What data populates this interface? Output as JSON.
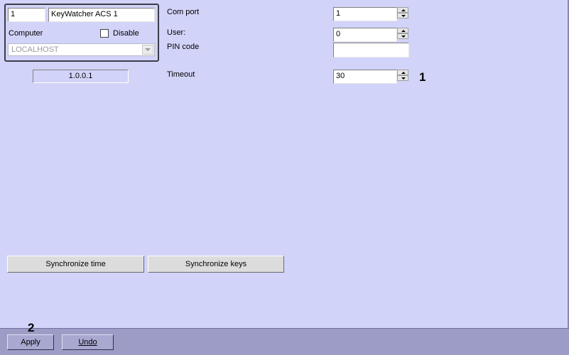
{
  "object_panel": {
    "id_value": "1",
    "name_value": "KeyWatcher ACS 1",
    "computer_label": "Computer",
    "disable_label": "Disable",
    "disable_checked": false,
    "computer_value": "LOCALHOST"
  },
  "version": "1.0.0.1",
  "settings": {
    "com_port_label": "Com port",
    "com_port_value": "1",
    "user_label": "User:",
    "user_value": "0",
    "pin_label": "PIN code",
    "pin_value": "",
    "timeout_label": "Timeout",
    "timeout_value": "30"
  },
  "actions": {
    "sync_time_label": "Synchronize time",
    "sync_keys_label": "Synchronize keys"
  },
  "bottom_bar": {
    "apply_label": "Apply",
    "undo_label": "Undo"
  },
  "annotations": {
    "marker_1": "1",
    "marker_2": "2"
  },
  "icons": {
    "spin_up": "triangle-up-icon",
    "spin_down": "triangle-down-icon",
    "dropdown": "chevron-down-icon"
  }
}
